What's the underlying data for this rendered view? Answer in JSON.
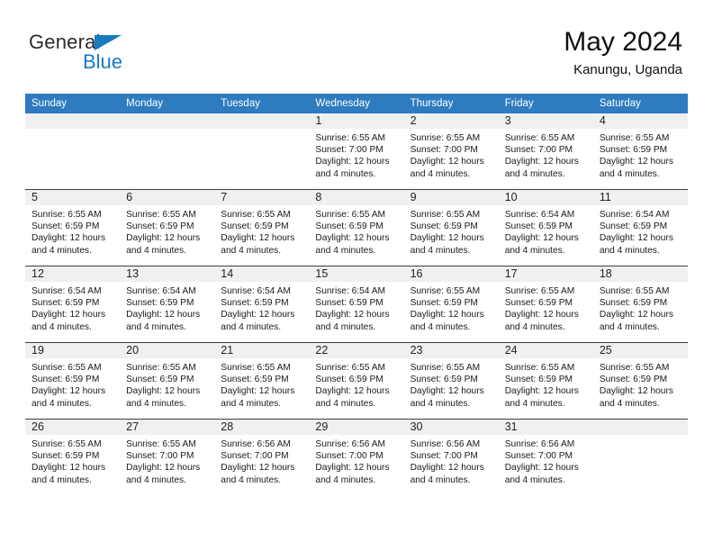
{
  "brand": {
    "name_top": "General",
    "name_bottom": "Blue",
    "triangle_color": "#1a7bc0"
  },
  "header": {
    "title": "May 2024",
    "subtitle": "Kanungu, Uganda",
    "header_bg": "#2e7bbf",
    "daynum_bg": "#f0f0f0"
  },
  "weekdays": [
    "Sunday",
    "Monday",
    "Tuesday",
    "Wednesday",
    "Thursday",
    "Friday",
    "Saturday"
  ],
  "labels": {
    "sunrise_prefix": "Sunrise:",
    "sunset_prefix": "Sunset:",
    "daylight_prefix": "Daylight:"
  },
  "weeks": [
    [
      {
        "day": "",
        "sunrise": "",
        "sunset": "",
        "daylight_line1": "",
        "daylight_line2": ""
      },
      {
        "day": "",
        "sunrise": "",
        "sunset": "",
        "daylight_line1": "",
        "daylight_line2": ""
      },
      {
        "day": "",
        "sunrise": "",
        "sunset": "",
        "daylight_line1": "",
        "daylight_line2": ""
      },
      {
        "day": "1",
        "sunrise": "Sunrise: 6:55 AM",
        "sunset": "Sunset: 7:00 PM",
        "daylight_line1": "Daylight: 12 hours",
        "daylight_line2": "and 4 minutes."
      },
      {
        "day": "2",
        "sunrise": "Sunrise: 6:55 AM",
        "sunset": "Sunset: 7:00 PM",
        "daylight_line1": "Daylight: 12 hours",
        "daylight_line2": "and 4 minutes."
      },
      {
        "day": "3",
        "sunrise": "Sunrise: 6:55 AM",
        "sunset": "Sunset: 7:00 PM",
        "daylight_line1": "Daylight: 12 hours",
        "daylight_line2": "and 4 minutes."
      },
      {
        "day": "4",
        "sunrise": "Sunrise: 6:55 AM",
        "sunset": "Sunset: 6:59 PM",
        "daylight_line1": "Daylight: 12 hours",
        "daylight_line2": "and 4 minutes."
      }
    ],
    [
      {
        "day": "5",
        "sunrise": "Sunrise: 6:55 AM",
        "sunset": "Sunset: 6:59 PM",
        "daylight_line1": "Daylight: 12 hours",
        "daylight_line2": "and 4 minutes."
      },
      {
        "day": "6",
        "sunrise": "Sunrise: 6:55 AM",
        "sunset": "Sunset: 6:59 PM",
        "daylight_line1": "Daylight: 12 hours",
        "daylight_line2": "and 4 minutes."
      },
      {
        "day": "7",
        "sunrise": "Sunrise: 6:55 AM",
        "sunset": "Sunset: 6:59 PM",
        "daylight_line1": "Daylight: 12 hours",
        "daylight_line2": "and 4 minutes."
      },
      {
        "day": "8",
        "sunrise": "Sunrise: 6:55 AM",
        "sunset": "Sunset: 6:59 PM",
        "daylight_line1": "Daylight: 12 hours",
        "daylight_line2": "and 4 minutes."
      },
      {
        "day": "9",
        "sunrise": "Sunrise: 6:55 AM",
        "sunset": "Sunset: 6:59 PM",
        "daylight_line1": "Daylight: 12 hours",
        "daylight_line2": "and 4 minutes."
      },
      {
        "day": "10",
        "sunrise": "Sunrise: 6:54 AM",
        "sunset": "Sunset: 6:59 PM",
        "daylight_line1": "Daylight: 12 hours",
        "daylight_line2": "and 4 minutes."
      },
      {
        "day": "11",
        "sunrise": "Sunrise: 6:54 AM",
        "sunset": "Sunset: 6:59 PM",
        "daylight_line1": "Daylight: 12 hours",
        "daylight_line2": "and 4 minutes."
      }
    ],
    [
      {
        "day": "12",
        "sunrise": "Sunrise: 6:54 AM",
        "sunset": "Sunset: 6:59 PM",
        "daylight_line1": "Daylight: 12 hours",
        "daylight_line2": "and 4 minutes."
      },
      {
        "day": "13",
        "sunrise": "Sunrise: 6:54 AM",
        "sunset": "Sunset: 6:59 PM",
        "daylight_line1": "Daylight: 12 hours",
        "daylight_line2": "and 4 minutes."
      },
      {
        "day": "14",
        "sunrise": "Sunrise: 6:54 AM",
        "sunset": "Sunset: 6:59 PM",
        "daylight_line1": "Daylight: 12 hours",
        "daylight_line2": "and 4 minutes."
      },
      {
        "day": "15",
        "sunrise": "Sunrise: 6:54 AM",
        "sunset": "Sunset: 6:59 PM",
        "daylight_line1": "Daylight: 12 hours",
        "daylight_line2": "and 4 minutes."
      },
      {
        "day": "16",
        "sunrise": "Sunrise: 6:55 AM",
        "sunset": "Sunset: 6:59 PM",
        "daylight_line1": "Daylight: 12 hours",
        "daylight_line2": "and 4 minutes."
      },
      {
        "day": "17",
        "sunrise": "Sunrise: 6:55 AM",
        "sunset": "Sunset: 6:59 PM",
        "daylight_line1": "Daylight: 12 hours",
        "daylight_line2": "and 4 minutes."
      },
      {
        "day": "18",
        "sunrise": "Sunrise: 6:55 AM",
        "sunset": "Sunset: 6:59 PM",
        "daylight_line1": "Daylight: 12 hours",
        "daylight_line2": "and 4 minutes."
      }
    ],
    [
      {
        "day": "19",
        "sunrise": "Sunrise: 6:55 AM",
        "sunset": "Sunset: 6:59 PM",
        "daylight_line1": "Daylight: 12 hours",
        "daylight_line2": "and 4 minutes."
      },
      {
        "day": "20",
        "sunrise": "Sunrise: 6:55 AM",
        "sunset": "Sunset: 6:59 PM",
        "daylight_line1": "Daylight: 12 hours",
        "daylight_line2": "and 4 minutes."
      },
      {
        "day": "21",
        "sunrise": "Sunrise: 6:55 AM",
        "sunset": "Sunset: 6:59 PM",
        "daylight_line1": "Daylight: 12 hours",
        "daylight_line2": "and 4 minutes."
      },
      {
        "day": "22",
        "sunrise": "Sunrise: 6:55 AM",
        "sunset": "Sunset: 6:59 PM",
        "daylight_line1": "Daylight: 12 hours",
        "daylight_line2": "and 4 minutes."
      },
      {
        "day": "23",
        "sunrise": "Sunrise: 6:55 AM",
        "sunset": "Sunset: 6:59 PM",
        "daylight_line1": "Daylight: 12 hours",
        "daylight_line2": "and 4 minutes."
      },
      {
        "day": "24",
        "sunrise": "Sunrise: 6:55 AM",
        "sunset": "Sunset: 6:59 PM",
        "daylight_line1": "Daylight: 12 hours",
        "daylight_line2": "and 4 minutes."
      },
      {
        "day": "25",
        "sunrise": "Sunrise: 6:55 AM",
        "sunset": "Sunset: 6:59 PM",
        "daylight_line1": "Daylight: 12 hours",
        "daylight_line2": "and 4 minutes."
      }
    ],
    [
      {
        "day": "26",
        "sunrise": "Sunrise: 6:55 AM",
        "sunset": "Sunset: 6:59 PM",
        "daylight_line1": "Daylight: 12 hours",
        "daylight_line2": "and 4 minutes."
      },
      {
        "day": "27",
        "sunrise": "Sunrise: 6:55 AM",
        "sunset": "Sunset: 7:00 PM",
        "daylight_line1": "Daylight: 12 hours",
        "daylight_line2": "and 4 minutes."
      },
      {
        "day": "28",
        "sunrise": "Sunrise: 6:56 AM",
        "sunset": "Sunset: 7:00 PM",
        "daylight_line1": "Daylight: 12 hours",
        "daylight_line2": "and 4 minutes."
      },
      {
        "day": "29",
        "sunrise": "Sunrise: 6:56 AM",
        "sunset": "Sunset: 7:00 PM",
        "daylight_line1": "Daylight: 12 hours",
        "daylight_line2": "and 4 minutes."
      },
      {
        "day": "30",
        "sunrise": "Sunrise: 6:56 AM",
        "sunset": "Sunset: 7:00 PM",
        "daylight_line1": "Daylight: 12 hours",
        "daylight_line2": "and 4 minutes."
      },
      {
        "day": "31",
        "sunrise": "Sunrise: 6:56 AM",
        "sunset": "Sunset: 7:00 PM",
        "daylight_line1": "Daylight: 12 hours",
        "daylight_line2": "and 4 minutes."
      },
      {
        "day": "",
        "sunrise": "",
        "sunset": "",
        "daylight_line1": "",
        "daylight_line2": ""
      }
    ]
  ]
}
